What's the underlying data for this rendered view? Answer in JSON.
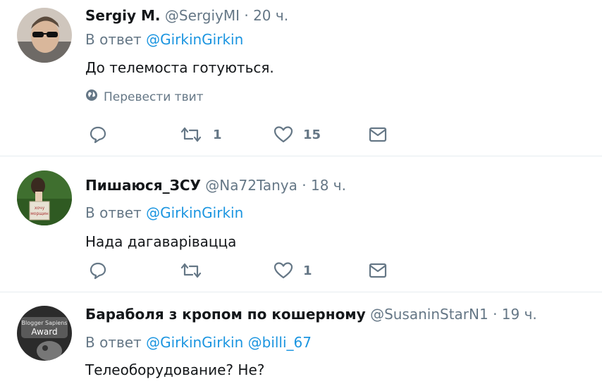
{
  "tweets": [
    {
      "name": "Sergiy M.",
      "handle": "@SergiyMI",
      "time": "20 ч.",
      "reply_prefix": "В ответ",
      "mentions": [
        "@GirkinGirkin"
      ],
      "text": "До телемоста готуються.",
      "translate": "Перевести твит",
      "retweets": "1",
      "likes": "15"
    },
    {
      "name": "Пишаюся_ЗСУ",
      "handle": "@Na72Tanya",
      "time": "18 ч.",
      "reply_prefix": "В ответ",
      "mentions": [
        "@GirkinGirkin"
      ],
      "text": "Нада дагаварівацца",
      "retweets": "",
      "likes": "1"
    },
    {
      "name": "Бараболя з кропом по кошерному",
      "handle": "@SusaninStarN1",
      "time": "19 ч.",
      "reply_prefix": "В ответ",
      "mentions": [
        "@GirkinGirkin",
        "@billi_67"
      ],
      "text": "Телеоборудование? Не?",
      "avatar_text": [
        "Blogger Sapiens",
        "Award"
      ]
    }
  ],
  "colors": {
    "link": "#1b95e0",
    "muted": "#657786",
    "text": "#14171a",
    "divider": "#e6ecf0"
  },
  "icons": [
    "reply-icon",
    "retweet-icon",
    "like-icon",
    "message-icon",
    "globe-icon"
  ]
}
